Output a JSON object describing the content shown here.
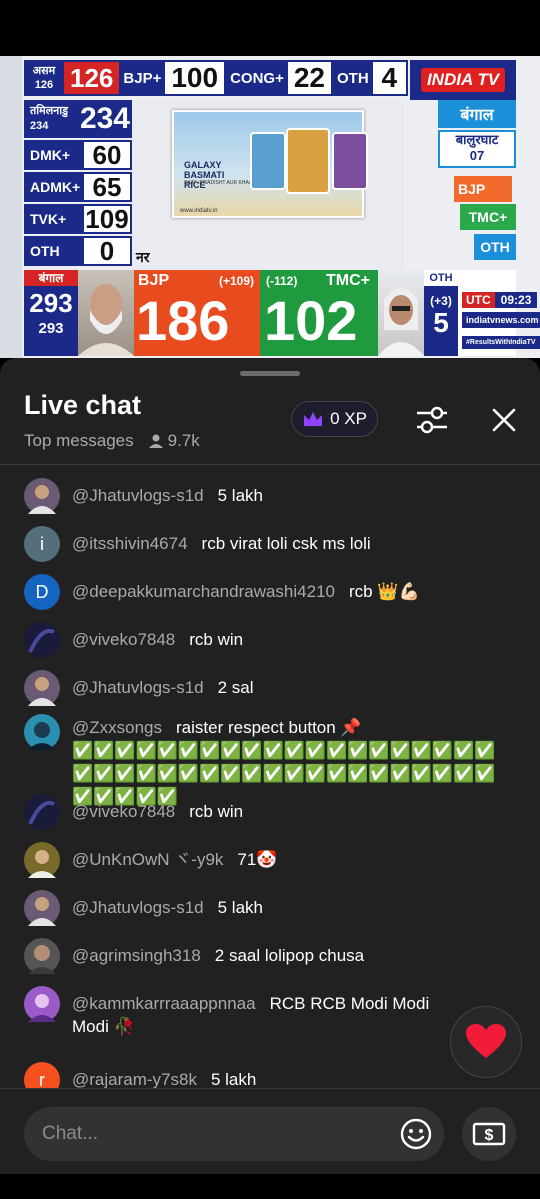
{
  "broadcast": {
    "top_strip": {
      "assam_label": "असम",
      "assam_total": "126",
      "assam_value": "126",
      "bjp_label": "BJP+",
      "bjp_value": "100",
      "cong_label": "CONG+",
      "cong_value": "22",
      "oth_label": "OTH",
      "oth_value": "4"
    },
    "logo": "INDIA TV",
    "left_col": [
      {
        "label": "तमिलनाडु",
        "sub": "234",
        "value": "234"
      },
      {
        "label": "DMK+",
        "value": "60"
      },
      {
        "label": "ADMK+",
        "value": "65"
      },
      {
        "label": "TVK+",
        "value": "109"
      },
      {
        "label": "OTH",
        "value": "0"
      }
    ],
    "ad": {
      "brand": "GALAXY BASMATI RICE",
      "tagline": "SAAF, SWADISHT AUR KHAAS",
      "url": "www.indiatv.in"
    },
    "ticker_word": "नर",
    "right_col": {
      "state": "बंगाल",
      "seat_name": "बालुरघाट",
      "seat_no": "07",
      "bjp": "BJP",
      "tmc": "TMC+",
      "oth": "OTH"
    },
    "bottom_strip": {
      "bengal_label": "बंगाल",
      "bengal_total": "293",
      "bengal_total2": "293",
      "bjp_label": "BJP",
      "bjp_change": "(+109)",
      "bjp_value": "186",
      "tmc_label": "TMC+",
      "tmc_change": "(-112)",
      "tmc_value": "102",
      "oth_label": "OTH",
      "oth_change": "(+3)",
      "oth_value": "5",
      "utc_label": "UTC",
      "time": "09:23",
      "site": "indiatvnews.com",
      "hashtag": "#ResultsWithIndiaTV"
    }
  },
  "chat": {
    "title": "Live chat",
    "mode": "Top messages",
    "viewers": "9.7k",
    "xp": "0 XP",
    "input_placeholder": "Chat...",
    "messages": [
      {
        "author": "@Jhatuvlogs-s1d",
        "text": "5 lakh",
        "avatar": "photo",
        "color": "#6b5a73"
      },
      {
        "author": "@itsshivin4674",
        "text": "rcb virat loli csk ms loli",
        "avatar": "i",
        "color": "#546e7a"
      },
      {
        "author": "@deepakkumarchandrawashi4210",
        "text": "rcb 👑💪🏻",
        "avatar": "D",
        "color": "#1565c0"
      },
      {
        "author": "@viveko7848",
        "text": "rcb win",
        "avatar": "photo",
        "color": "#1a1a3a"
      },
      {
        "author": "@Jhatuvlogs-s1d",
        "text": "2 sal",
        "avatar": "photo",
        "color": "#6b5a73"
      },
      {
        "author": "@Zxxsongs",
        "text": "raister respect button 📌✅✅✅✅✅✅✅✅✅✅✅✅✅✅✅✅✅✅✅✅✅✅✅✅✅✅✅✅✅✅✅✅✅✅✅✅✅✅✅✅✅✅✅✅✅",
        "avatar": "photo",
        "color": "#2a8fb0"
      },
      {
        "author": "@viveko7848",
        "text": "rcb win",
        "avatar": "photo",
        "color": "#1a1a3a"
      },
      {
        "author": "@UnKnOwN ヾ-y9k",
        "text": "71🤡",
        "avatar": "photo",
        "color": "#7a6a2a"
      },
      {
        "author": "@Jhatuvlogs-s1d",
        "text": "5 lakh",
        "avatar": "photo",
        "color": "#6b5a73"
      },
      {
        "author": "@agrimsingh318",
        "text": "2 saal lolipop chusa",
        "avatar": "photo",
        "color": "#555555"
      },
      {
        "author": "@kammkarrraaappnnaa",
        "text": "RCB RCB Modi Modi Modi 🥀",
        "avatar": "photo",
        "color": "#9a5ac8"
      },
      {
        "author": "@rajaram-y7s8k",
        "text": "5 lakh",
        "avatar": "r",
        "color": "#f4511e"
      }
    ]
  }
}
